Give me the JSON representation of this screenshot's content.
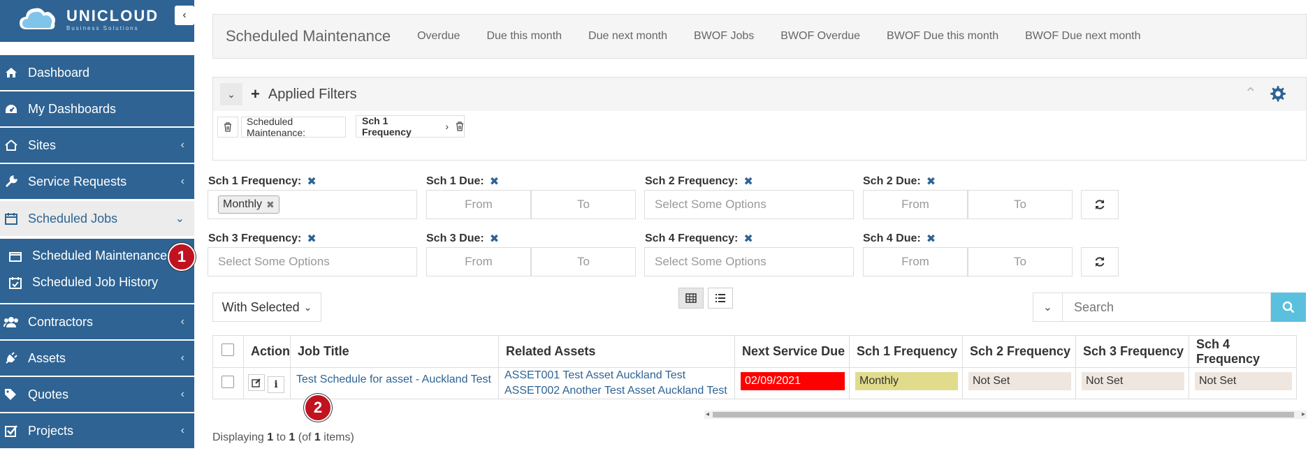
{
  "brand": {
    "name": "UNICLOUD",
    "tagline": "Business Solutions"
  },
  "sidebar": {
    "items": [
      {
        "label": "Dashboard"
      },
      {
        "label": "My Dashboards"
      },
      {
        "label": "Sites"
      },
      {
        "label": "Service Requests"
      },
      {
        "label": "Scheduled Jobs"
      },
      {
        "label": "Contractors"
      },
      {
        "label": "Assets"
      },
      {
        "label": "Quotes"
      },
      {
        "label": "Projects"
      }
    ],
    "sub_items": [
      {
        "label": "Scheduled Maintenance"
      },
      {
        "label": "Scheduled Job History"
      }
    ]
  },
  "markers": {
    "m1": "1",
    "m2": "2"
  },
  "tabs": {
    "title": "Scheduled Maintenance",
    "items": [
      {
        "label": "Overdue"
      },
      {
        "label": "Due this month"
      },
      {
        "label": "Due next month"
      },
      {
        "label": "BWOF Jobs"
      },
      {
        "label": "BWOF Overdue"
      },
      {
        "label": "BWOF Due this month"
      },
      {
        "label": "BWOF Due next month"
      }
    ]
  },
  "applied_filters": {
    "title": "Applied Filters",
    "chip1": "Scheduled Maintenance:",
    "chip2": "Sch 1 Frequency"
  },
  "filters": {
    "sch1_freq": {
      "label": "Sch 1 Frequency:",
      "tag": "Monthly"
    },
    "sch1_due": {
      "label": "Sch 1 Due:",
      "from": "From",
      "to": "To"
    },
    "sch2_freq": {
      "label": "Sch 2 Frequency:",
      "placeholder": "Select Some Options"
    },
    "sch2_due": {
      "label": "Sch 2 Due:",
      "from": "From",
      "to": "To"
    },
    "sch3_freq": {
      "label": "Sch 3 Frequency:",
      "placeholder": "Select Some Options"
    },
    "sch3_due": {
      "label": "Sch 3 Due:",
      "from": "From",
      "to": "To"
    },
    "sch4_freq": {
      "label": "Sch 4 Frequency:",
      "placeholder": "Select Some Options"
    },
    "sch4_due": {
      "label": "Sch 4 Due:",
      "from": "From",
      "to": "To"
    }
  },
  "toolbar": {
    "with_selected": "With Selected",
    "search_placeholder": "Search"
  },
  "table": {
    "headers": {
      "action": "Action",
      "job_title": "Job Title",
      "related_assets": "Related Assets",
      "next_service_due": "Next Service Due",
      "sch1": "Sch 1 Frequency",
      "sch2": "Sch 2 Frequency",
      "sch3": "Sch 3 Frequency",
      "sch4": "Sch 4 Frequency"
    },
    "rows": [
      {
        "job_title": "Test Schedule for asset - Auckland Test",
        "asset1": "ASSET001 Test Asset Auckland Test",
        "asset2": "ASSET002 Another Test Asset Auckland Test",
        "next_service_due": "02/09/2021",
        "sch1": "Monthly",
        "sch2": "Not Set",
        "sch3": "Not Set",
        "sch4": "Not Set"
      }
    ]
  },
  "footer": {
    "prefix": "Displaying",
    "from": "1",
    "to_word": "to",
    "to": "1",
    "of_open": "(of",
    "total": "1",
    "suffix": "items)"
  },
  "colors": {
    "sidebar": "#2e6393",
    "overdue": "#ff0000",
    "monthly": "#e0dc8c",
    "not_set": "#efe6df",
    "search_button": "#5bc0de"
  }
}
